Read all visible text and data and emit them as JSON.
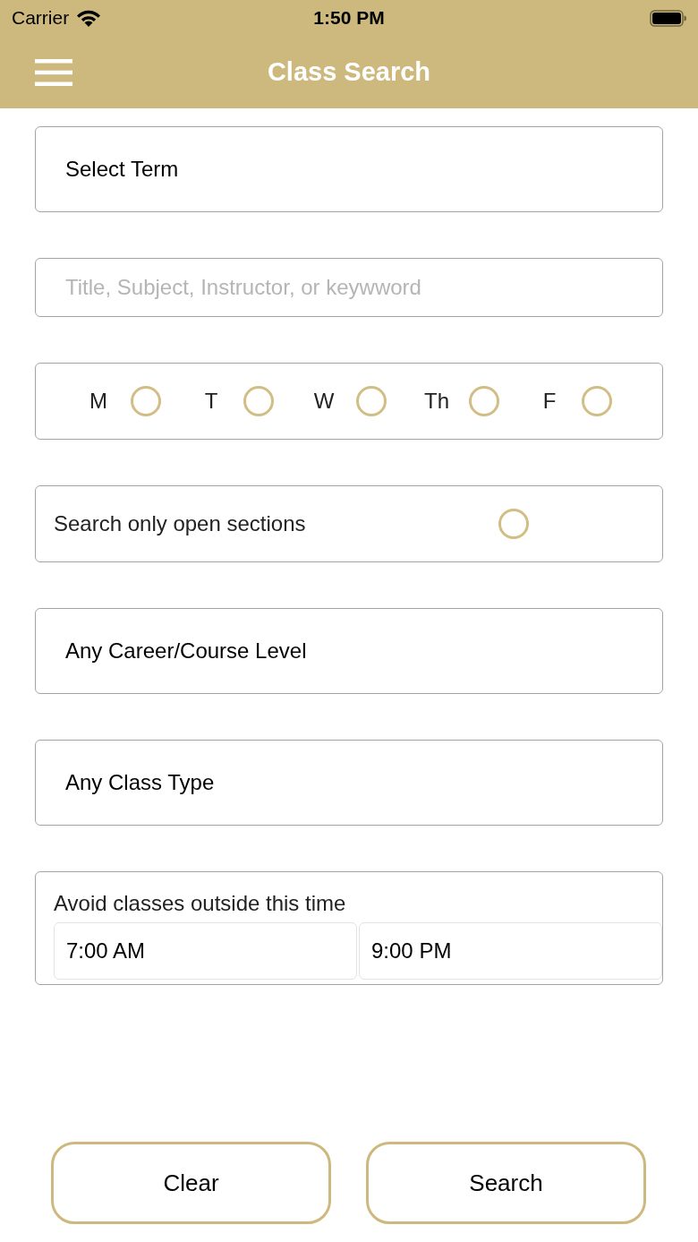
{
  "status_bar": {
    "carrier": "Carrier",
    "time": "1:50 PM"
  },
  "nav_bar": {
    "title": "Class Search"
  },
  "form": [
    {
      "kind": "select",
      "value": "Select Term"
    },
    {
      "kind": "text",
      "placeholder": "Title, Subject, Instructor, or keywword"
    },
    {
      "kind": "days",
      "days": [
        {
          "label": "M",
          "checked": false
        },
        {
          "label": "T",
          "checked": false
        },
        {
          "label": "W",
          "checked": false
        },
        {
          "label": "Th",
          "checked": false
        },
        {
          "label": "F",
          "checked": false
        }
      ]
    },
    {
      "kind": "toggle",
      "label": "Search only open sections",
      "checked": false
    },
    {
      "kind": "select",
      "value": "Any Career/Course Level"
    },
    {
      "kind": "select",
      "value": "Any Class Type"
    },
    {
      "kind": "time_range",
      "label": "Avoid classes outside this time",
      "start": "7:00 AM",
      "end": "9:00 PM"
    }
  ],
  "buttons": [
    {
      "label": "Clear"
    },
    {
      "label": "Search"
    }
  ]
}
